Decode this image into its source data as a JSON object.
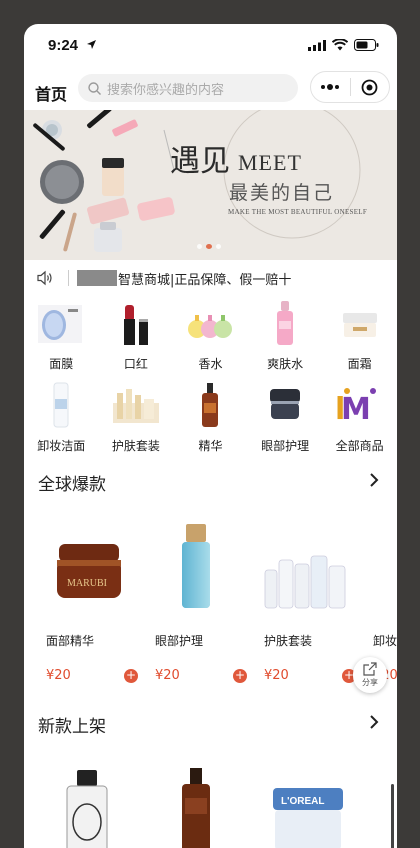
{
  "status_bar": {
    "time": "9:24"
  },
  "header": {
    "title": "首页",
    "search_placeholder": "搜索你感兴趣的内容"
  },
  "banner": {
    "title_cn": "遇见",
    "title_en": "MEET",
    "subtitle": "最美的自己",
    "tagline": "MAKE THE MOST BEAUTIFUL ONESELF"
  },
  "notice": {
    "text": "智慧商城|正品保障、假一赔十"
  },
  "categories": [
    {
      "label": "面膜",
      "icon": "mask-product"
    },
    {
      "label": "口红",
      "icon": "lipstick-product"
    },
    {
      "label": "香水",
      "icon": "perfume-product"
    },
    {
      "label": "爽肤水",
      "icon": "toner-product"
    },
    {
      "label": "面霜",
      "icon": "cream-product"
    },
    {
      "label": "卸妆洁面",
      "icon": "cleanser-product"
    },
    {
      "label": "护肤套装",
      "icon": "skincare-set-product"
    },
    {
      "label": "精华",
      "icon": "serum-product"
    },
    {
      "label": "眼部护理",
      "icon": "eye-cream-product"
    },
    {
      "label": "全部商品",
      "icon": "all-products-logo"
    }
  ],
  "hot_section": {
    "title": "全球爆款",
    "products": [
      {
        "name": "面部精华",
        "price": "¥20"
      },
      {
        "name": "眼部护理",
        "price": "¥20"
      },
      {
        "name": "护肤套装",
        "price": "¥20"
      },
      {
        "name": "卸妆",
        "price": "¥20"
      }
    ]
  },
  "new_section": {
    "title": "新款上架"
  },
  "share": {
    "label": "分享"
  },
  "colors": {
    "accent": "#e04b2d",
    "add_button": "#e0583b"
  }
}
